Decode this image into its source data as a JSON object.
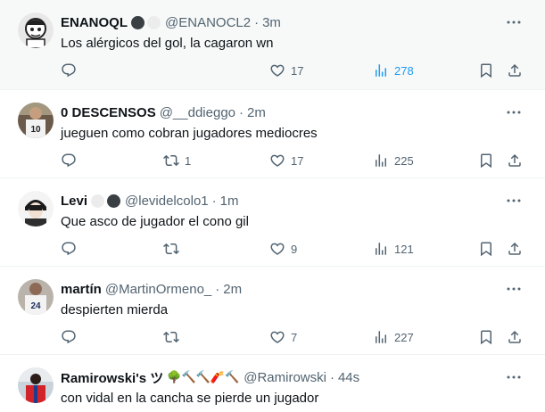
{
  "tweets": [
    {
      "name": "ENANOQL",
      "handle": "@ENANOCL2",
      "time": "3m",
      "text": "Los alérgicos del gol, la cagaron wn",
      "replies": "",
      "retweets": "",
      "likes": "17",
      "views": "278",
      "views_color": "#1d9bf0"
    },
    {
      "name": "0 DESCENSOS",
      "handle": "@__ddieggo",
      "time": "2m",
      "text": "jueguen como cobran jugadores mediocres",
      "replies": "",
      "retweets": "1",
      "likes": "17",
      "views": "225"
    },
    {
      "name": "Levi",
      "handle": "@levidelcolo1",
      "time": "1m",
      "text": "Que asco de jugador el cono gil",
      "replies": "",
      "retweets": "",
      "likes": "9",
      "views": "121"
    },
    {
      "name": "martín",
      "handle": "@MartinOrmeno_",
      "time": "2m",
      "text": "despierten mierda",
      "replies": "",
      "retweets": "",
      "likes": "7",
      "views": "227"
    },
    {
      "name": "Ramirowski's ツ",
      "name_emoji": "🌳🔨🔨🧨🔨",
      "handle": "@Ramirowski",
      "time": "44s",
      "text": "con vidal en la cancha se pierde un jugador"
    }
  ],
  "separator": "·",
  "icons": {
    "reply": "reply-icon",
    "retweet": "retweet-icon",
    "like": "heart-icon",
    "views": "views-icon",
    "bookmark": "bookmark-icon",
    "share": "share-icon",
    "more": "more-icon"
  }
}
